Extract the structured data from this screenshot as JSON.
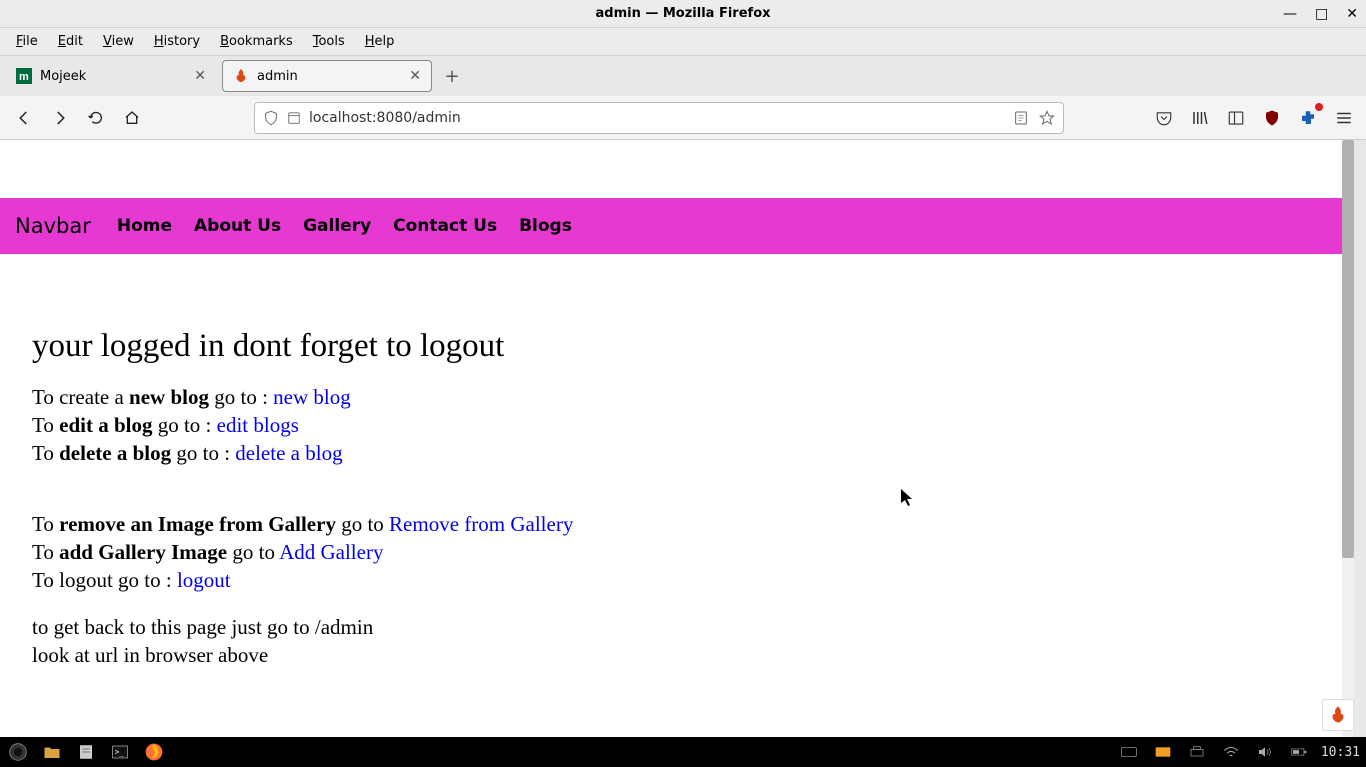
{
  "window": {
    "title": "admin — Mozilla Firefox"
  },
  "menubar": {
    "items": [
      "File",
      "Edit",
      "View",
      "History",
      "Bookmarks",
      "Tools",
      "Help"
    ]
  },
  "tabs": [
    {
      "label": "Mojeek",
      "active": false,
      "icon": "mojeek"
    },
    {
      "label": "admin",
      "active": true,
      "icon": "codeigniter"
    }
  ],
  "urlbar": {
    "url": "localhost:8080/admin"
  },
  "page": {
    "navbar": {
      "brand": "Navbar",
      "links": [
        "Home",
        "About Us",
        "Gallery",
        "Contact Us",
        "Blogs"
      ]
    },
    "heading": "your logged in dont forget to logout",
    "lines1": [
      {
        "pre": "To create a ",
        "bold": "new blog",
        "mid": " go to : ",
        "link": "new blog"
      },
      {
        "pre": "To ",
        "bold": "edit a blog",
        "mid": " go to : ",
        "link": "edit blogs"
      },
      {
        "pre": "To ",
        "bold": "delete a blog",
        "mid": " go to : ",
        "link": "delete a blog"
      }
    ],
    "lines2": [
      {
        "pre": "To ",
        "bold": "remove an Image from Gallery",
        "mid": " go to ",
        "link": "Remove from Gallery"
      },
      {
        "pre": "To ",
        "bold": "add Gallery Image",
        "mid": " go to ",
        "link": "Add Gallery"
      },
      {
        "pre": "To logout go to : ",
        "bold": "",
        "mid": "",
        "link": "logout"
      }
    ],
    "footer1": "to get back to this page just go to /admin",
    "footer2": "look at url in browser above"
  },
  "taskbar": {
    "clock": "10:31"
  }
}
